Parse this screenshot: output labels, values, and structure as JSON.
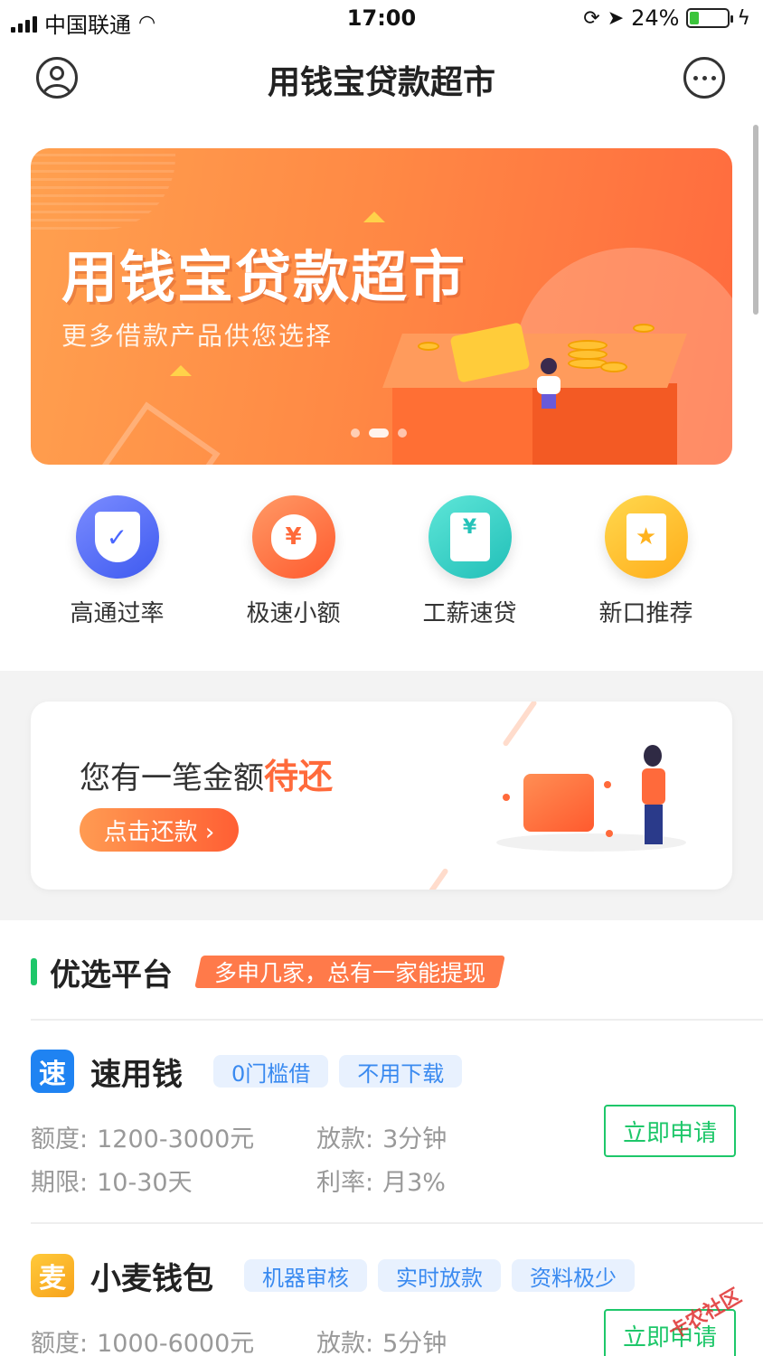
{
  "status_bar": {
    "carrier": "中国联通",
    "time": "17:00",
    "battery": "24%",
    "battery_level": 0.24
  },
  "header": {
    "title": "用钱宝贷款超市"
  },
  "banner": {
    "title": "用钱宝贷款超市",
    "subtitle": "更多借款产品供您选择",
    "page_count": 3,
    "active_page": 2
  },
  "quick_nav": [
    {
      "label": "高通过率",
      "icon": "shield-check-icon",
      "color": "#4a66ff"
    },
    {
      "label": "极速小额",
      "icon": "money-bag-icon",
      "color": "#ff6a3b"
    },
    {
      "label": "工薪速贷",
      "icon": "receipt-icon",
      "color": "#23c2b8"
    },
    {
      "label": "新口推荐",
      "icon": "star-bookmark-icon",
      "color": "#ffb21d"
    }
  ],
  "repay_card": {
    "text": "您有一笔金额",
    "highlight": "待还",
    "button": "点击还款 ›"
  },
  "section": {
    "title": "优选平台",
    "tag": "多申几家，总有一家能提现"
  },
  "products": [
    {
      "logo_char": "速",
      "name": "速用钱",
      "tags": [
        "0门槛借",
        "不用下载"
      ],
      "amount_label": "额度:",
      "amount": "1200-3000元",
      "term_label": "期限:",
      "term": "10-30天",
      "disburse_label": "放款:",
      "disburse": "3分钟",
      "rate_label": "利率:",
      "rate": "月3%",
      "button": "立即申请"
    },
    {
      "logo_char": "麦",
      "name": "小麦钱包",
      "tags": [
        "机器审核",
        "实时放款",
        "资料极少"
      ],
      "amount_label": "额度:",
      "amount": "1000-6000元",
      "disburse_label": "放款:",
      "disburse": "5分钟",
      "button": "立即申请"
    }
  ],
  "watermark": "卡农社区",
  "colors": {
    "accent_green": "#1ec76a",
    "accent_orange": "#ff6a3b",
    "tag_blue": "#3a8af0"
  }
}
